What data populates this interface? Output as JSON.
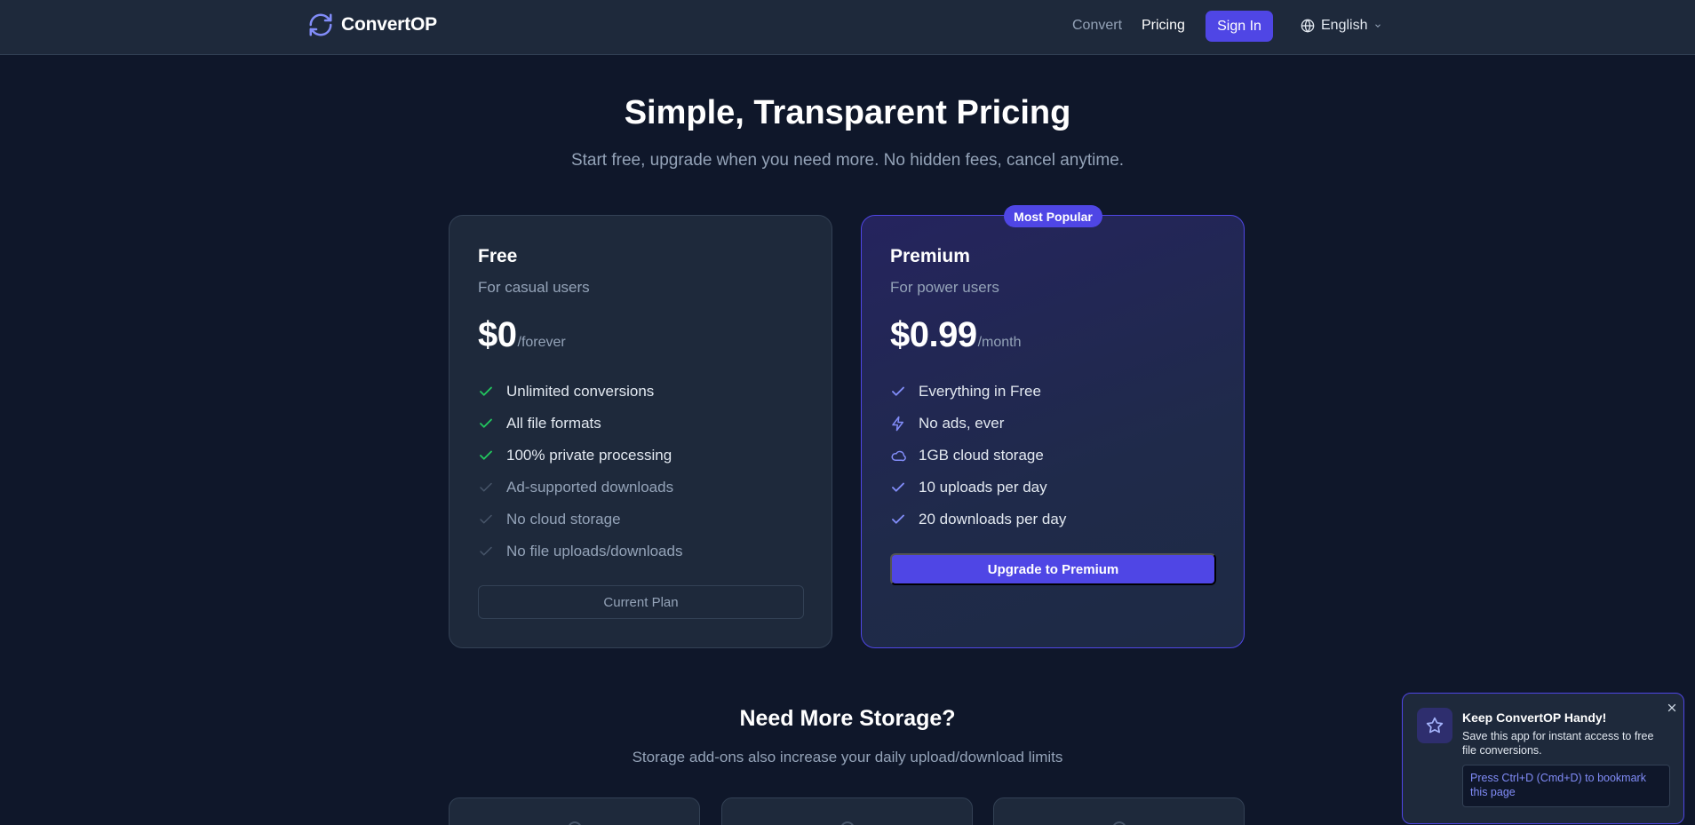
{
  "header": {
    "brand": "ConvertOP",
    "nav": {
      "convert": "Convert",
      "pricing": "Pricing"
    },
    "signin_label": "Sign In",
    "language": "English"
  },
  "hero": {
    "title": "Simple, Transparent Pricing",
    "subtitle": "Start free, upgrade when you need more. No hidden fees, cancel anytime."
  },
  "plans": {
    "free": {
      "name": "Free",
      "description": "For casual users",
      "price": "$0",
      "period": "/forever",
      "features": [
        {
          "text": "Unlimited conversions",
          "icon": "check-icon",
          "muted": false
        },
        {
          "text": "All file formats",
          "icon": "check-icon",
          "muted": false
        },
        {
          "text": "100% private processing",
          "icon": "check-icon",
          "muted": false
        },
        {
          "text": "Ad-supported downloads",
          "icon": "check-icon",
          "muted": true
        },
        {
          "text": "No cloud storage",
          "icon": "check-icon",
          "muted": true
        },
        {
          "text": "No file uploads/downloads",
          "icon": "check-icon",
          "muted": true
        }
      ],
      "button_label": "Current Plan"
    },
    "premium": {
      "badge": "Most Popular",
      "name": "Premium",
      "description": "For power users",
      "price": "$0.99",
      "period": "/month",
      "features": [
        {
          "text": "Everything in Free",
          "icon": "check-icon"
        },
        {
          "text": "No ads, ever",
          "icon": "lightning-icon"
        },
        {
          "text": "1GB cloud storage",
          "icon": "cloud-icon"
        },
        {
          "text": "10 uploads per day",
          "icon": "check-icon"
        },
        {
          "text": "20 downloads per day",
          "icon": "check-icon"
        }
      ],
      "button_label": "Upgrade to Premium"
    }
  },
  "storage": {
    "title": "Need More Storage?",
    "subtitle": "Storage add-ons also increase your daily upload/download limits"
  },
  "toast": {
    "title": "Keep ConvertOP Handy!",
    "body": "Save this app for instant access to free file conversions.",
    "hint": "Press Ctrl+D (Cmd+D) to bookmark this page"
  },
  "colors": {
    "background": "#0f172a",
    "surface": "#1e293b",
    "accent": "#4f46e5",
    "check_green": "#22c55e",
    "check_indigo": "#818cf8"
  }
}
